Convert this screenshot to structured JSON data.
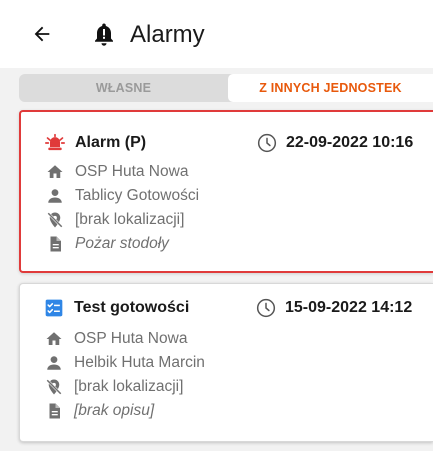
{
  "header": {
    "title": "Alarmy",
    "back_icon": "arrow-left-icon",
    "title_icon": "bell-icon"
  },
  "tabs": [
    {
      "label": "WŁASNE",
      "active": false
    },
    {
      "label": "Z INNYCH JEDNOSTEK",
      "active": true
    }
  ],
  "colors": {
    "accent": "#e8590c",
    "alarm_red": "#e03a3a",
    "test_blue": "#2f86e6",
    "muted_text": "#707070"
  },
  "alarms": [
    {
      "type_icon": "alarm-siren-icon",
      "title": "Alarm (P)",
      "datetime": "22-09-2022 10:16",
      "unit": "OSP Huta Nowa",
      "author": "Tablicy Gotowości",
      "location": "[brak lokalizacji]",
      "description": "Pożar stodoły",
      "highlighted": true
    },
    {
      "type_icon": "checklist-icon",
      "title": "Test gotowości",
      "datetime": "15-09-2022 14:12",
      "unit": "OSP Huta Nowa",
      "author": "Helbik Huta Marcin",
      "location": "[brak lokalizacji]",
      "description": "[brak opisu]",
      "highlighted": false
    }
  ]
}
